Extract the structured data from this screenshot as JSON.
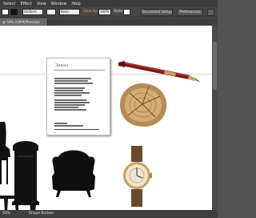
{
  "menubar": {
    "items": [
      "Select",
      "Effect",
      "View",
      "Window",
      "Help"
    ]
  },
  "control_bar": {
    "stroke_value": "Uniform",
    "style_value": "Basic",
    "opacity_label": "Opacity:",
    "opacity_value": "100%",
    "style_label": "Style:",
    "document_setup_label": "Document Setup",
    "preferences_label": "Preferences"
  },
  "document": {
    "tab_label": "@ 50% (CMYK/Preview)"
  },
  "artboard": {
    "title": "Заказ"
  },
  "status_bar": {
    "zoom": "50%",
    "tool_label": "Shape Builder"
  },
  "icons": [
    "pen-object",
    "wood-slice-object",
    "watch-object",
    "chair-silhouette",
    "cabinet-silhouette",
    "sofa-silhouette",
    "table-silhouette"
  ],
  "colors": {
    "canvas": "#ffffff",
    "chrome": "#535353",
    "accent_guide": "#7a9fd0"
  }
}
